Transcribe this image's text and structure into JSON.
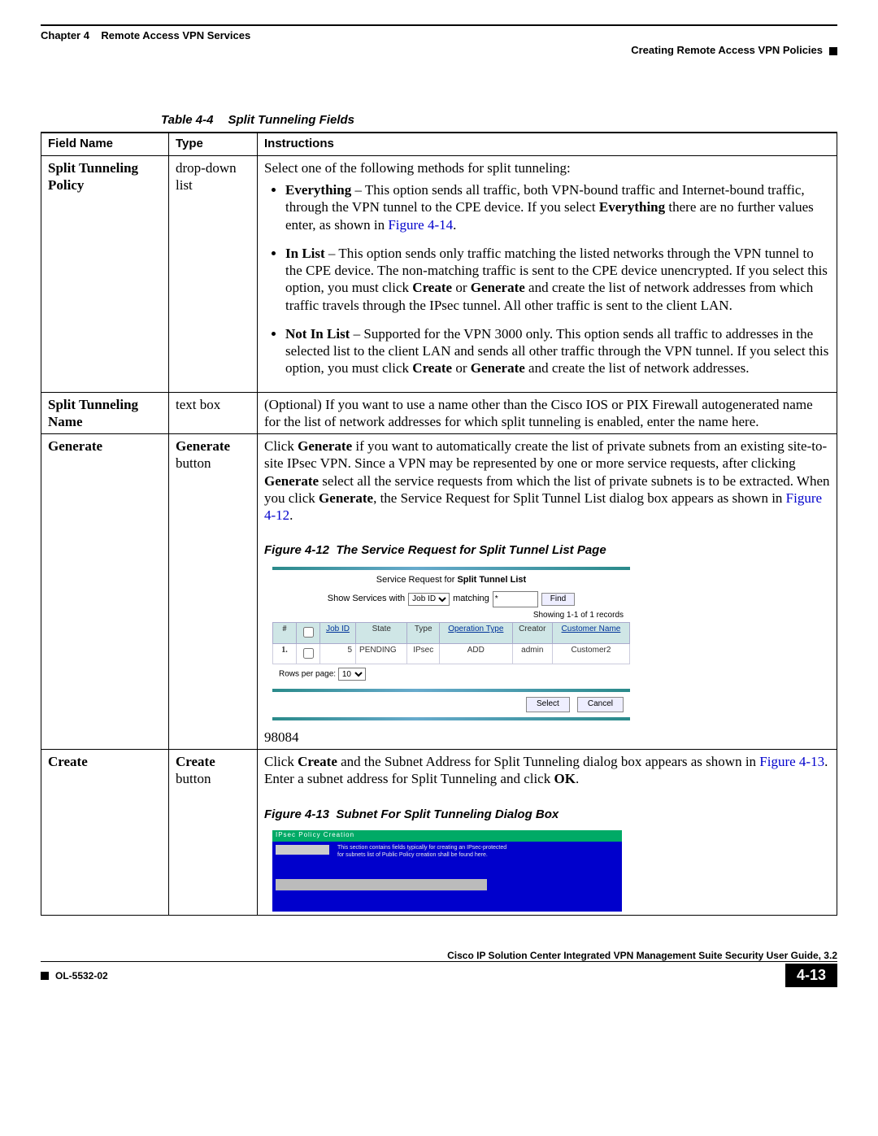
{
  "header": {
    "chapter": "Chapter 4",
    "chapter_title": "Remote Access VPN Services",
    "section": "Creating Remote Access VPN Policies"
  },
  "table_caption": {
    "ref": "Table 4-4",
    "title": "Split Tunneling Fields"
  },
  "columns": [
    "Field Name",
    "Type",
    "Instructions"
  ],
  "rows": [
    {
      "field": "Split Tunneling Policy",
      "type": "drop-down list",
      "intro": "Select one of the following methods for split tunneling:",
      "bullets": [
        {
          "lead": "Everything",
          "text": " – This option sends all traffic, both VPN-bound traffic and Internet-bound traffic, through the VPN tunnel to the CPE device. If you select ",
          "bold2": "Everything",
          "tail": " there are no further values enter, as shown in ",
          "xref": "Figure 4-14",
          "post": "."
        },
        {
          "lead": "In List",
          "text": " – This option sends only traffic matching the listed networks through the VPN tunnel to the CPE device. The non-matching traffic is sent to the CPE device unencrypted. If you select this option, you must click ",
          "bold2": "Create",
          "mid": " or ",
          "bold3": "Generate",
          "tail": " and create the list of network addresses from which traffic travels through the IPsec tunnel. All other traffic is sent to the client LAN."
        },
        {
          "lead": "Not In List",
          "text": " – Supported for the VPN 3000 only. This option sends all traffic to addresses in the selected list to the client LAN and sends all other traffic through the VPN tunnel. If you select this option, you must click ",
          "bold2": "Create",
          "mid": " or ",
          "bold3": "Generate",
          "tail": " and create the list of network addresses."
        }
      ]
    },
    {
      "field": "Split Tunneling Name",
      "type": "text box",
      "instr": "(Optional) If you want to use a name other than the Cisco IOS or PIX Firewall autogenerated name for the list of network addresses for which split tunneling is enabled, enter the name here."
    },
    {
      "field": "Generate",
      "type_bold": "Generate",
      "type_suffix": " button",
      "instr_parts": {
        "p1": "Click ",
        "b1": "Generate",
        "p2": " if you want to automatically create the list of private subnets from an existing site-to-site IPsec VPN. Since a VPN may be represented by one or more service requests, after clicking ",
        "b2": "Generate",
        "p3": " select all the service requests from which the list of private subnets is to be extracted. When you click ",
        "b3": "Generate",
        "p4": ", the Service Request for Split Tunnel List dialog box appears as shown in ",
        "xref": "Figure 4-12",
        "p5": "."
      },
      "fig_caption": {
        "ref": "Figure 4-12",
        "title": "The Service Request for Split Tunnel List Page"
      },
      "fig": {
        "title_plain": "Service Request for ",
        "title_bold": "Split Tunnel List",
        "show_label": "Show Services with",
        "dropdown": "Job ID",
        "matching": "matching",
        "match_val": "*",
        "find": "Find",
        "records": "Showing 1-1 of 1 records",
        "headers": [
          "#",
          "",
          "Job ID",
          "State",
          "Type",
          "Operation Type",
          "Creator",
          "Customer Name"
        ],
        "row": [
          "1.",
          "",
          "5",
          "PENDING",
          "IPsec",
          "ADD",
          "admin",
          "Customer2"
        ],
        "rpp_label": "Rows per page:",
        "rpp_val": "10",
        "buttons": [
          "Select",
          "Cancel"
        ],
        "sideid": "98084"
      }
    },
    {
      "field": "Create",
      "type_bold": "Create",
      "type_suffix": " button",
      "instr_parts": {
        "p1": "Click ",
        "b1": "Create",
        "p2": " and the Subnet Address for Split Tunneling dialog box appears as shown in ",
        "xref": "Figure 4-13",
        "p3": ". Enter a subnet address for Split Tunneling and click ",
        "b2": "OK",
        "p4": "."
      },
      "fig_caption": {
        "ref": "Figure 4-13",
        "title": "Subnet For Split Tunneling Dialog Box"
      },
      "fig13": {
        "bar": "IPsec Policy Creation",
        "t1": "This section contains fields typically for creating an IPsec-protected",
        "t2": "for subnets list of Public Policy creation shall be found here."
      }
    }
  ],
  "footer": {
    "doc": "Cisco IP Solution Center Integrated VPN Management Suite Security User Guide, 3.2",
    "ol": "OL-5532-02",
    "page": "4-13"
  }
}
